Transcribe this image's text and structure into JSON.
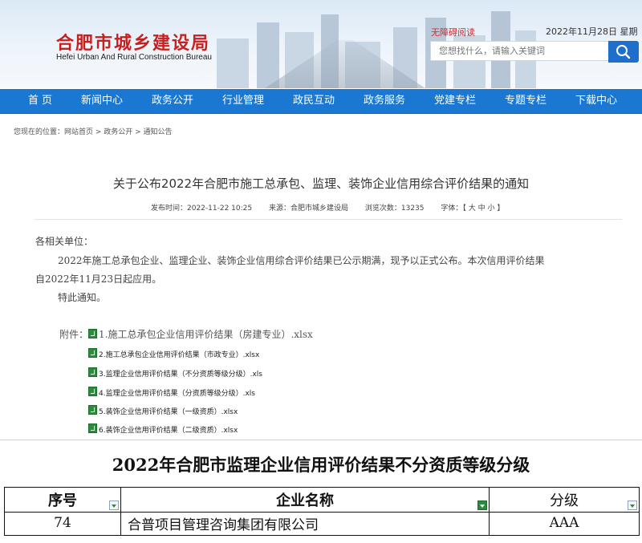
{
  "header": {
    "logo_cn": "合肥市城乡建设局",
    "logo_en": "Hefei Urban And Rural Construction Bureau",
    "accessibility_link": "无障碍阅读",
    "date": "2022年11月28日 星期一",
    "search_placeholder": "您想找什么，请输入关键词"
  },
  "nav": {
    "items": [
      "首 页",
      "新闻中心",
      "政务公开",
      "行业管理",
      "政民互动",
      "政务服务",
      "党建专栏",
      "专题专栏",
      "下载中心"
    ]
  },
  "breadcrumb": "您现在的位置：网站首页 > 政务公开 > 通知公告",
  "article": {
    "title": "关于公布2022年合肥市施工总承包、监理、装饰企业信用综合评价结果的通知",
    "publish_time": "发布时间：2022-11-22 10:25",
    "source": "来源：合肥市城乡建设局",
    "views": "浏览次数：13235",
    "font_size": "字体：【 大 中 小 】",
    "salutation": "各相关单位：",
    "paragraph_line1": "2022年施工总承包企业、监理企业、装饰企业信用综合评价结果已公示期满，现予以正式公布。本次信用评价结果",
    "paragraph_line2": "自2022年11月23日起应用。",
    "closing": "特此通知。",
    "attachments_label": "附件：",
    "attachments": [
      "1.施工总承包企业信用评价结果（房建专业）.xlsx",
      "2.施工总承包企业信用评价结果（市政专业）.xlsx",
      "3.监理企业信用评价结果（不分资质等级分级）.xls",
      "4.监理企业信用评价结果（分资质等级分级）.xls",
      "5.装饰企业信用评价结果（一级资质）.xlsx",
      "6.装饰企业信用评价结果（二级资质）.xlsx"
    ]
  },
  "sheet": {
    "title": "2022年合肥市监理企业信用评价结果不分资质等级分级",
    "headers": [
      "序号",
      "企业名称",
      "分级"
    ],
    "row": [
      "74",
      "合普项目管理咨询集团有限公司",
      "AAA"
    ]
  },
  "colors": {
    "nav_bg": "#1a78d2",
    "logo_red": "#c8201f",
    "search_button": "#1e6fcc"
  }
}
